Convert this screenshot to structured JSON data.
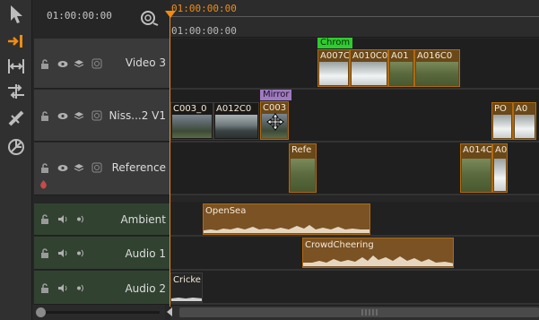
{
  "header": {
    "timecode": "01:00:00:00",
    "ruler_timecode_top": "01:00:00:00",
    "ruler_timecode_bottom": "01:00:00:00"
  },
  "tools": [
    {
      "name": "select-tool-icon"
    },
    {
      "name": "track-insert-tool-icon"
    },
    {
      "name": "ripple-tool-icon"
    },
    {
      "name": "slip-tool-icon"
    },
    {
      "name": "razor-tool-icon"
    },
    {
      "name": "link-tool-icon"
    }
  ],
  "tracks": {
    "video3": {
      "name": "Video 3"
    },
    "video2": {
      "name": "Niss...2 V1"
    },
    "reference": {
      "name": "Reference"
    },
    "ambient": {
      "name": "Ambient"
    },
    "audio1": {
      "name": "Audio 1"
    },
    "audio2": {
      "name": "Audio 2"
    }
  },
  "clips": {
    "v3_1": "A007C",
    "v3_2": "A010C0",
    "v3_3": "A01",
    "v3_4": "A016C0",
    "v2_1": "C003_0",
    "v2_2": "A012C0",
    "v2_3": "C003",
    "v2_4": "PO",
    "v2_5": "A0",
    "ref_1": "Refe",
    "ref_2": "A014C",
    "ref_3": "A0"
  },
  "effects": {
    "chrom": "Chrom",
    "mirror": "Mirror"
  },
  "audio_clips": {
    "opensea": "OpenSea",
    "crowd": "CrowdCheering",
    "cricket": "Cricke"
  },
  "colors": {
    "playhead": "#f08c12",
    "clip_border": "#b06a10",
    "chrom_tag": "#2ecc2e",
    "mirror_tag": "#a07ac0"
  }
}
